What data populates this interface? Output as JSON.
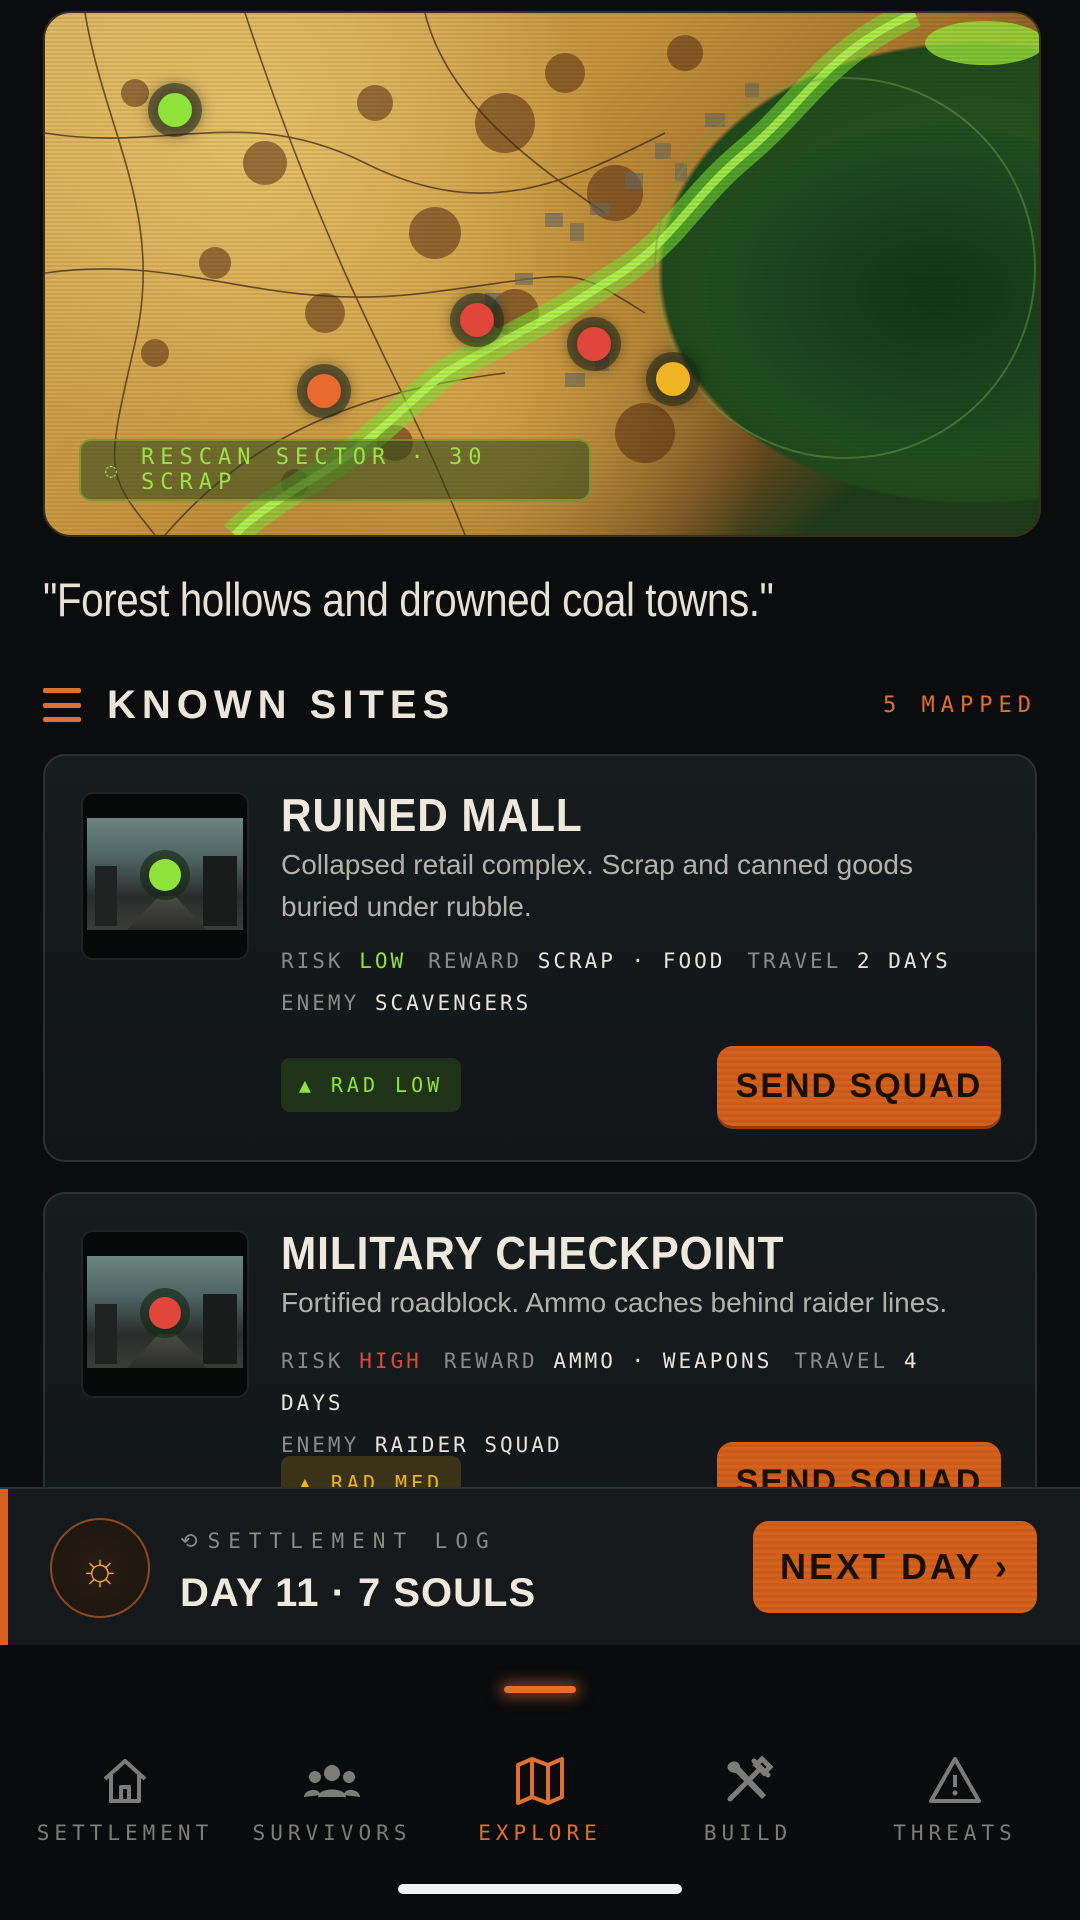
{
  "map": {
    "rescan_icon": "refresh-icon",
    "rescan_label": "RESCAN SECTOR · 30 SCRAP",
    "pin_colors": {
      "green": "#8fe33a",
      "red": "#e1463a",
      "orange": "#e86a2e",
      "yellow": "#f0b323"
    }
  },
  "quote": "\"Forest hollows and drowned coal towns.\"",
  "sites": {
    "title": "KNOWN SITES",
    "count": "5 MAPPED",
    "items": [
      {
        "title": "RUINED MALL",
        "desc": "Collapsed retail complex. Scrap and canned goods buried under rubble.",
        "risk_label": "RISK",
        "risk": "LOW",
        "reward_label": "REWARD",
        "reward": "SCRAP · FOOD",
        "travel_label": "TRAVEL",
        "travel": "2 DAYS",
        "enemy_label": "ENEMY",
        "enemy": "SCAVENGERS",
        "rad": "▲ RAD LOW",
        "button": "SEND SQUAD"
      },
      {
        "title": "MILITARY CHECKPOINT",
        "desc": "Fortified roadblock. Ammo caches behind raider lines.",
        "risk_label": "RISK",
        "risk": "HIGH",
        "reward_label": "REWARD",
        "reward": "AMMO · WEAPONS",
        "travel_label": "TRAVEL",
        "travel": "4 DAYS",
        "enemy_label": "ENEMY",
        "enemy": "RAIDER SQUAD",
        "rad": "▲ RAD MED",
        "button": "SEND SQUAD"
      }
    ]
  },
  "log": {
    "label": "SETTLEMENT LOG",
    "day": "DAY 11 · 7 SOULS",
    "next": "NEXT DAY ›"
  },
  "nav": {
    "tabs": [
      {
        "label": "SETTLEMENT",
        "icon": "home-icon"
      },
      {
        "label": "SURVIVORS",
        "icon": "people-icon"
      },
      {
        "label": "EXPLORE",
        "icon": "map-icon",
        "active": true
      },
      {
        "label": "BUILD",
        "icon": "tools-icon"
      },
      {
        "label": "THREATS",
        "icon": "warning-icon"
      }
    ]
  }
}
